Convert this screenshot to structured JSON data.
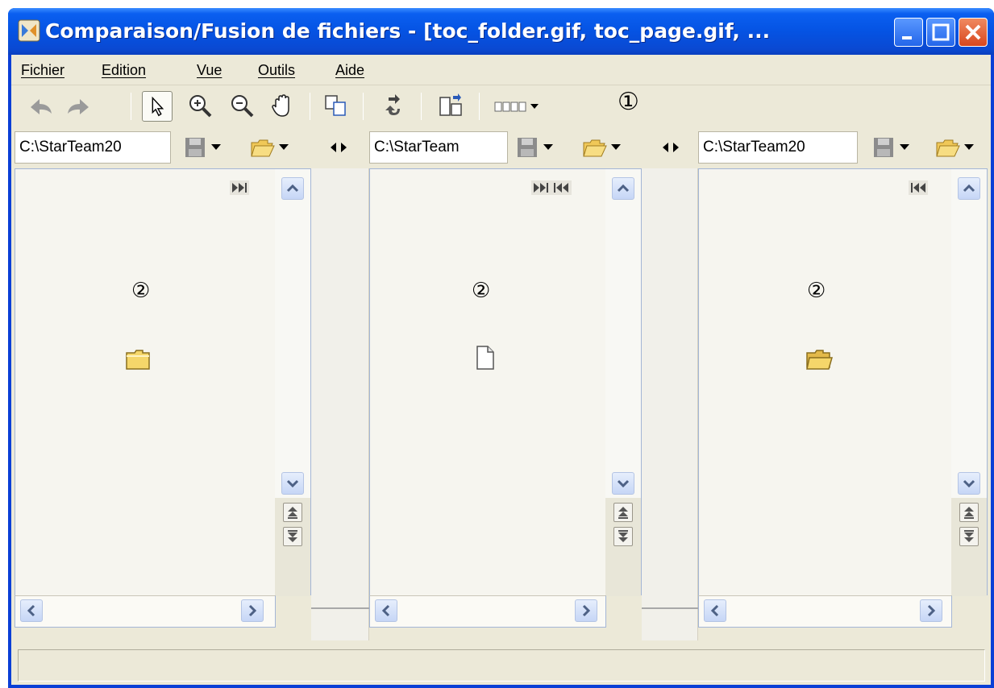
{
  "window": {
    "title": "Comparaison/Fusion de fichiers - [toc_folder.gif, toc_page.gif, ...",
    "title_color": "#0553e3"
  },
  "menu": {
    "items": [
      "Fichier",
      "Edition",
      "Vue",
      "Outils",
      "Aide"
    ]
  },
  "toolbar": {
    "callout": "①",
    "buttons": [
      "back-icon",
      "forward-icon",
      "pointer-icon",
      "zoom-in-icon",
      "zoom-out-icon",
      "hand-icon",
      "copy-icon",
      "swap-icon",
      "layout-icon",
      "columns-icon"
    ]
  },
  "panes": [
    {
      "path": "C:\\StarTeam20",
      "callout": "②",
      "icon": "folder-closed-icon",
      "nav": "next"
    },
    {
      "path": "C:\\StarTeam",
      "callout": "②",
      "icon": "page-icon",
      "nav": "both"
    },
    {
      "path": "C:\\StarTeam20",
      "callout": "②",
      "icon": "folder-open-icon",
      "nav": "prev"
    }
  ],
  "statusbar": {
    "text": ""
  },
  "colors": {
    "chrome": "#ece9d8",
    "pane_border": "#a4b6d6",
    "scroll_button": "#c6d6f6",
    "folder_yellow": "#f5d66a"
  }
}
